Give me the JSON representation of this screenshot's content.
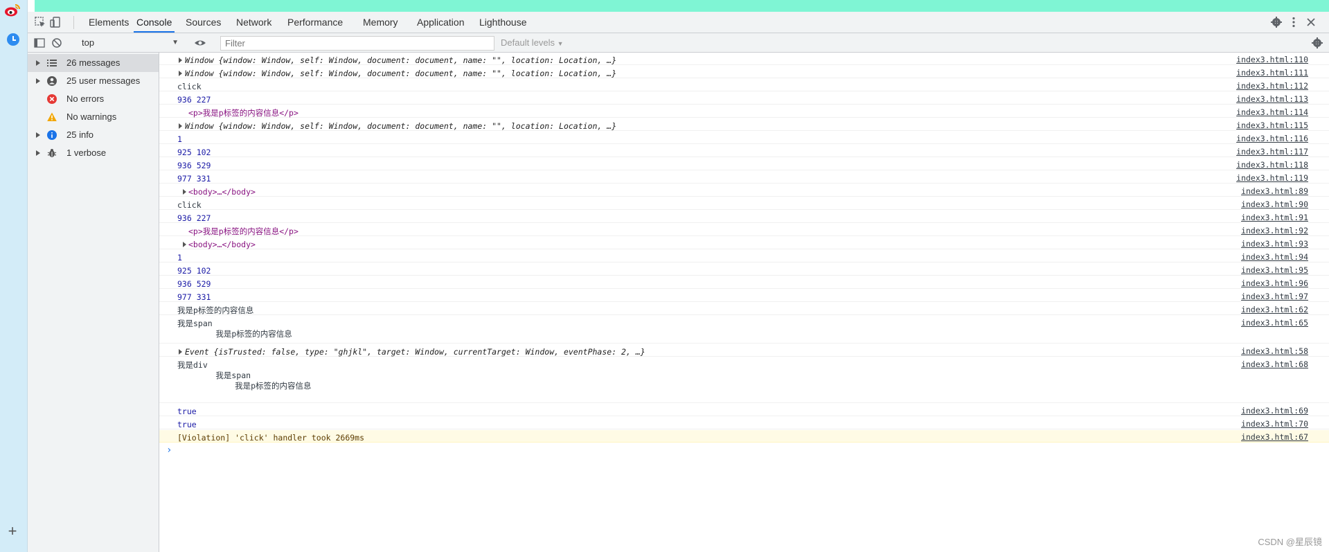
{
  "devtools": {
    "tabs": [
      {
        "label": "Elements"
      },
      {
        "label": "Console"
      },
      {
        "label": "Sources"
      },
      {
        "label": "Network"
      },
      {
        "label": "Performance"
      },
      {
        "label": "Memory"
      },
      {
        "label": "Application"
      },
      {
        "label": "Lighthouse"
      }
    ],
    "active_tab": "Console"
  },
  "toolbar": {
    "context": "top",
    "filter_placeholder": "Filter",
    "levels": "Default levels"
  },
  "sidebar": {
    "items": [
      {
        "label": "26 messages",
        "icon": "list-icon",
        "expandable": true,
        "selected": true
      },
      {
        "label": "25 user messages",
        "icon": "user-icon",
        "expandable": true
      },
      {
        "label": "No errors",
        "icon": "error-icon",
        "expandable": false
      },
      {
        "label": "No warnings",
        "icon": "warning-icon",
        "expandable": false
      },
      {
        "label": "25 info",
        "icon": "info-icon",
        "expandable": true
      },
      {
        "label": "1 verbose",
        "icon": "bug-icon",
        "expandable": true
      }
    ]
  },
  "console": {
    "rows": [
      {
        "text": "Window {window: Window, self: Window, document: document, name: \"\", location: Location, …}",
        "source": "index3.html:110",
        "kind": "object"
      },
      {
        "text": "Window {window: Window, self: Window, document: document, name: \"\", location: Location, …}",
        "source": "index3.html:111",
        "kind": "object"
      },
      {
        "text": "click",
        "source": "index3.html:112",
        "kind": "plain"
      },
      {
        "text": "936 227",
        "source": "index3.html:113",
        "kind": "number"
      },
      {
        "text": "<p>我是p标签的内容信息</p>",
        "source": "index3.html:114",
        "kind": "element"
      },
      {
        "text": "Window {window: Window, self: Window, document: document, name: \"\", location: Location, …}",
        "source": "index3.html:115",
        "kind": "object"
      },
      {
        "text": "1",
        "source": "index3.html:116",
        "kind": "number"
      },
      {
        "text": "925 102",
        "source": "index3.html:117",
        "kind": "number"
      },
      {
        "text": "936 529",
        "source": "index3.html:118",
        "kind": "number"
      },
      {
        "text": "977 331",
        "source": "index3.html:119",
        "kind": "number"
      },
      {
        "text": "<body>…</body>",
        "source": "index3.html:89",
        "kind": "collapsed-element"
      },
      {
        "text": "click",
        "source": "index3.html:90",
        "kind": "plain"
      },
      {
        "text": "936 227",
        "source": "index3.html:91",
        "kind": "number"
      },
      {
        "text": "<p>我是p标签的内容信息</p>",
        "source": "index3.html:92",
        "kind": "element"
      },
      {
        "text": "<body>…</body>",
        "source": "index3.html:93",
        "kind": "collapsed-element"
      },
      {
        "text": "1",
        "source": "index3.html:94",
        "kind": "number"
      },
      {
        "text": "925 102",
        "source": "index3.html:95",
        "kind": "number"
      },
      {
        "text": "936 529",
        "source": "index3.html:96",
        "kind": "number"
      },
      {
        "text": "977 331",
        "source": "index3.html:97",
        "kind": "number"
      },
      {
        "text": "我是p标签的内容信息",
        "source": "index3.html:62",
        "kind": "plain"
      },
      {
        "text": "我是span\n        我是p标签的内容信息",
        "source": "index3.html:65",
        "kind": "plain"
      },
      {
        "text": "Event {isTrusted: false, type: \"ghjkl\", target: Window, currentTarget: Window, eventPhase: 2, …}",
        "source": "index3.html:58",
        "kind": "object"
      },
      {
        "text": "我是div\n        我是span\n            我是p标签的内容信息",
        "source": "index3.html:68",
        "kind": "plain"
      },
      {
        "text": "true",
        "source": "index3.html:69",
        "kind": "number"
      },
      {
        "text": "true",
        "source": "index3.html:70",
        "kind": "number"
      },
      {
        "text": "[Violation] 'click' handler took 2669ms",
        "source": "index3.html:67",
        "kind": "violation"
      }
    ],
    "prompt": "›"
  },
  "watermark": "CSDN @星辰镜",
  "colors": {
    "accent": "#1a73e8",
    "top_strip": "#7ff5d4",
    "browser_sidebar": "#d3ecf8",
    "violation_bg": "#fffbe5"
  }
}
